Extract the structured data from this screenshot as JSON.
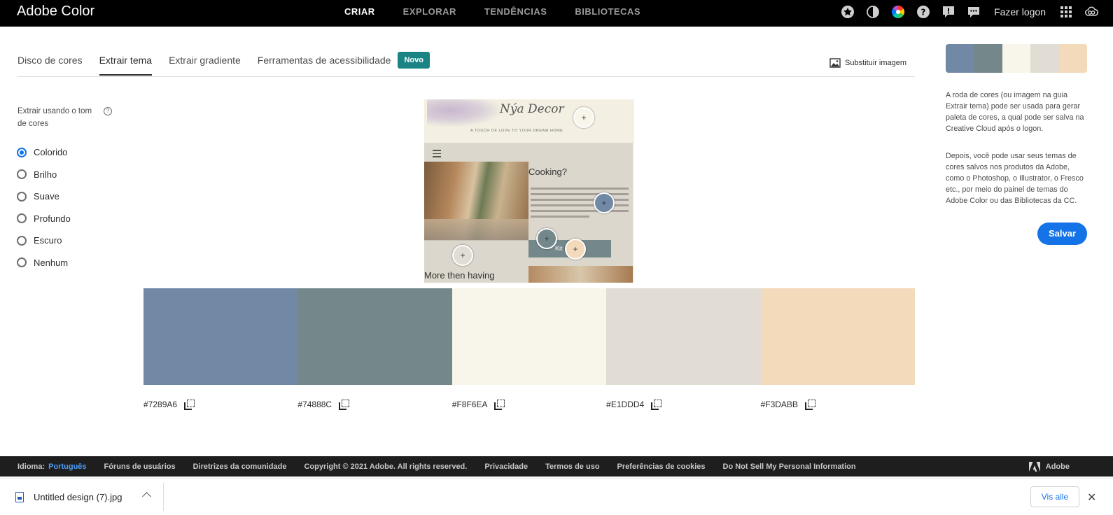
{
  "app": {
    "title": "Adobe Color"
  },
  "nav": {
    "items": [
      {
        "label": "CRIAR",
        "active": true
      },
      {
        "label": "EXPLORAR",
        "active": false
      },
      {
        "label": "TENDÊNCIAS",
        "active": false
      },
      {
        "label": "BIBLIOTECAS",
        "active": false
      }
    ],
    "login": "Fazer logon",
    "icons": [
      "star-icon",
      "moon-icon",
      "color-wheel-icon",
      "help-icon",
      "alert-icon",
      "chat-icon",
      "apps-grid-icon",
      "creative-cloud-icon"
    ]
  },
  "tabs": [
    {
      "label": "Disco de cores",
      "active": false
    },
    {
      "label": "Extrair tema",
      "active": true
    },
    {
      "label": "Extrair gradiente",
      "active": false
    },
    {
      "label": "Ferramentas de acessibilidade",
      "active": false
    }
  ],
  "badge": "Novo",
  "replace_image": "Substituir imagem",
  "options": {
    "label": "Extrair usando o tom de cores",
    "selected": "Colorido",
    "items": [
      "Colorido",
      "Brilho",
      "Suave",
      "Profundo",
      "Escuro",
      "Nenhum"
    ]
  },
  "preview": {
    "script_title": "Nýa Decor",
    "tagline": "A TOUCH OF LOVE TO YOUR DREAM HOME",
    "heading": "Cooking?",
    "button": "Kit",
    "bottom_text": "More then having"
  },
  "palette": [
    {
      "hex": "#7289A6",
      "color": "#7289A6"
    },
    {
      "hex": "#74888C",
      "color": "#74888C"
    },
    {
      "hex": "#F8F6EA",
      "color": "#F8F6EA"
    },
    {
      "hex": "#E1DDD4",
      "color": "#E1DDD4"
    },
    {
      "hex": "#F3DABB",
      "color": "#F3DABB"
    }
  ],
  "right": {
    "text1": "A roda de cores (ou imagem na guia Extrair tema) pode ser usada para gerar paleta de cores, a qual pode ser salva na Creative Cloud após o logon.",
    "text2": "Depois, você pode usar seus temas de cores salvos nos produtos da Adobe, como o Photoshop, o Illustrator, o Fresco etc., por meio do painel de temas do Adobe Color ou das Bibliotecas da CC.",
    "save": "Salvar"
  },
  "footer": {
    "lang_label": "Idioma:",
    "lang": "Português",
    "links": [
      "Fóruns de usuários",
      "Diretrizes da comunidade",
      "Copyright © 2021 Adobe. All rights reserved.",
      "Privacidade",
      "Termos de uso",
      "Preferências de cookies",
      "Do Not Sell My Personal Information"
    ],
    "brand": "Adobe"
  },
  "download": {
    "filename": "Untitled design (7).jpg",
    "show_all": "Vis alle"
  }
}
